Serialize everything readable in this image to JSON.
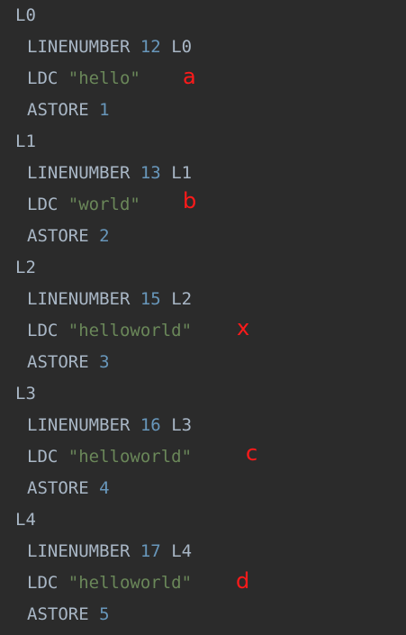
{
  "blocks": [
    {
      "label": "L0",
      "linenumber_keyword": "LINENUMBER",
      "line_no": "12",
      "line_label": "L0",
      "ldc_keyword": "LDC",
      "ldc_value": "\"hello\"",
      "astore_keyword": "ASTORE",
      "astore_index": "1",
      "annotation": "a"
    },
    {
      "label": "L1",
      "linenumber_keyword": "LINENUMBER",
      "line_no": "13",
      "line_label": "L1",
      "ldc_keyword": "LDC",
      "ldc_value": "\"world\"",
      "astore_keyword": "ASTORE",
      "astore_index": "2",
      "annotation": "b"
    },
    {
      "label": "L2",
      "linenumber_keyword": "LINENUMBER",
      "line_no": "15",
      "line_label": "L2",
      "ldc_keyword": "LDC",
      "ldc_value": "\"helloworld\"",
      "astore_keyword": "ASTORE",
      "astore_index": "3",
      "annotation": "x"
    },
    {
      "label": "L3",
      "linenumber_keyword": "LINENUMBER",
      "line_no": "16",
      "line_label": "L3",
      "ldc_keyword": "LDC",
      "ldc_value": "\"helloworld\"",
      "astore_keyword": "ASTORE",
      "astore_index": "4",
      "annotation": "c"
    },
    {
      "label": "L4",
      "linenumber_keyword": "LINENUMBER",
      "line_no": "17",
      "line_label": "L4",
      "ldc_keyword": "LDC",
      "ldc_value": "\"helloworld\"",
      "astore_keyword": "ASTORE",
      "astore_index": "5",
      "annotation": "d"
    }
  ],
  "colors": {
    "background": "#2b2b2b",
    "text": "#a9b7c6",
    "number": "#6897bb",
    "string": "#6a8759",
    "annotation": "#ff1a1a"
  }
}
